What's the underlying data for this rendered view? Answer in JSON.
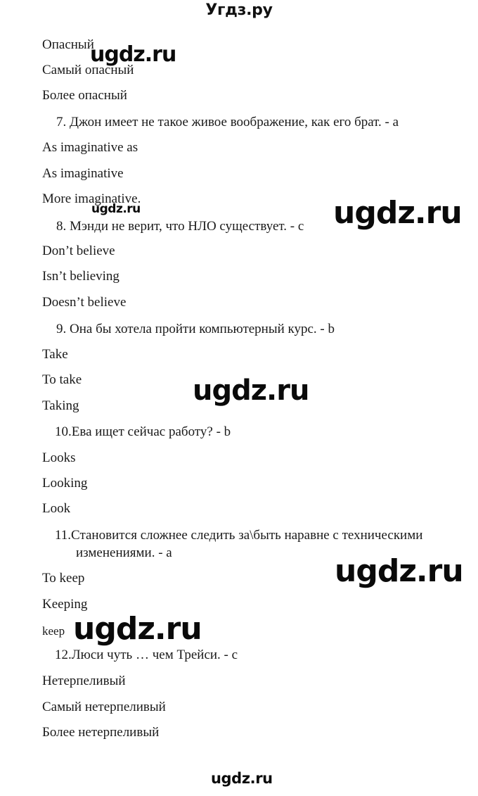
{
  "site": {
    "header_title": "Угдз.ру",
    "watermark_text": "ugdz.ru",
    "footer_watermark": "ugdz.ru"
  },
  "document": {
    "lines": [
      {
        "id": "l1",
        "text": "Опасный"
      },
      {
        "id": "l2",
        "text": "Самый опасный"
      },
      {
        "id": "l3",
        "text": "Более опасный"
      },
      {
        "id": "l4",
        "text": "7.  Джон имеет не такое живое воображение, как его брат. - a"
      },
      {
        "id": "l5",
        "text": "As imaginative as"
      },
      {
        "id": "l6",
        "text": "As imaginative"
      },
      {
        "id": "l7",
        "text": "More imaginative."
      },
      {
        "id": "l8",
        "text": "8.  Мэнди не верит, что НЛО существует. - c"
      },
      {
        "id": "l9",
        "text": "Don’t believe"
      },
      {
        "id": "l10",
        "text": "Isn’t believing"
      },
      {
        "id": "l11",
        "text": "Doesn’t believe"
      },
      {
        "id": "l12",
        "text": "9.  Она бы хотела пройти компьютерный курс. - b"
      },
      {
        "id": "l13",
        "text": "Take"
      },
      {
        "id": "l14",
        "text": "To take"
      },
      {
        "id": "l15",
        "text": "Taking"
      },
      {
        "id": "l16",
        "text": "10.Ева ищет сейчас работу? - b"
      },
      {
        "id": "l17",
        "text": "Looks"
      },
      {
        "id": "l18",
        "text": "Looking"
      },
      {
        "id": "l19",
        "text": "Look"
      },
      {
        "id": "l20",
        "text": "11.Становится сложнее следить за\\быть наравне с техническими"
      },
      {
        "id": "l21",
        "text": "изменениями. - a"
      },
      {
        "id": "l22",
        "text": "To keep"
      },
      {
        "id": "l23",
        "text": "Keeping"
      },
      {
        "id": "l24",
        "text": "keep"
      },
      {
        "id": "l25",
        "text": "12.Люси чуть … чем Трейси. - c"
      },
      {
        "id": "l26",
        "text": "Нетерпеливый"
      },
      {
        "id": "l27",
        "text": "Самый нетерпеливый"
      },
      {
        "id": "l28",
        "text": "Более нетерпеливый"
      }
    ]
  },
  "watermarks": [
    {
      "id": "w1",
      "text": "ugdz.ru"
    },
    {
      "id": "w2",
      "text": "ugdz.ru"
    },
    {
      "id": "w3",
      "text": "ugdz.ru"
    },
    {
      "id": "w4",
      "text": "ugdz.ru"
    },
    {
      "id": "w5",
      "text": "ugdz.ru"
    },
    {
      "id": "w6",
      "text": "ugdz.ru"
    },
    {
      "id": "w7",
      "text": "ugdz.ru"
    },
    {
      "id": "w8",
      "text": "ugdz.ru"
    }
  ],
  "colors": {
    "page_background": "#ffffff",
    "text": "#1a1a1a",
    "watermark": "#0a0a0a"
  }
}
